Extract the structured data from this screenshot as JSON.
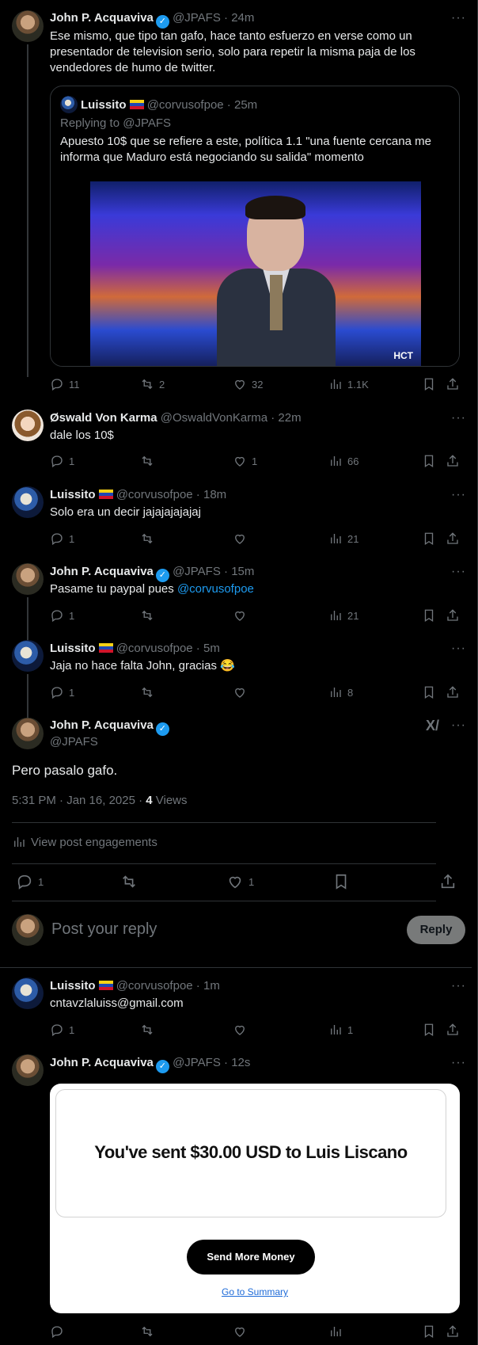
{
  "tweets": [
    {
      "name": "John P. Acquaviva",
      "handle": "@JPAFS",
      "time": "24m",
      "text": "Ese mismo, que tipo tan gafo, hace tanto esfuerzo en verse como un presentador de television serio, solo para repetir la misma paja de los vendedores de humo de twitter.",
      "replies": "11",
      "reposts": "2",
      "likes": "32",
      "views": "1.1K"
    },
    {
      "name": "Øswald Von Karma",
      "handle": "@OswaldVonKarma",
      "time": "22m",
      "text": "dale los 10$",
      "replies": "1",
      "reposts": "",
      "likes": "1",
      "views": "66"
    },
    {
      "name": "Luissito",
      "handle": "@corvusofpoe",
      "time": "18m",
      "text": "Solo era un decir jajajajajajaj",
      "replies": "1",
      "reposts": "",
      "likes": "",
      "views": "21"
    },
    {
      "name": "John P. Acquaviva",
      "handle": "@JPAFS",
      "time": "15m",
      "text": "Pasame tu paypal pues ",
      "mention": "@corvusofpoe",
      "replies": "1",
      "reposts": "",
      "likes": "",
      "views": "21"
    },
    {
      "name": "Luissito",
      "handle": "@corvusofpoe",
      "time": "5m",
      "text": "Jaja no hace falta John, gracias 😂",
      "replies": "1",
      "reposts": "",
      "likes": "",
      "views": "8"
    },
    {
      "name": "Luissito",
      "handle": "@corvusofpoe",
      "time": "1m",
      "text": "cntavzlaluiss@gmail.com",
      "replies": "1",
      "reposts": "",
      "likes": "",
      "views": "1"
    },
    {
      "name": "John P. Acquaviva",
      "handle": "@JPAFS",
      "time": "12s"
    }
  ],
  "quote": {
    "name": "Luissito",
    "handle": "@corvusofpoe",
    "time": "25m",
    "replying_to": "Replying to @JPAFS",
    "text": "Apuesto 10$ que se refiere a este, política 1.1 \"una fuente cercana me informa que Maduro está negociando su salida\" momento",
    "image_logo": "HCT"
  },
  "focus": {
    "name": "John P. Acquaviva",
    "handle": "@JPAFS",
    "text": "Pero pasalo gafo.",
    "timestamp": "5:31 PM · Jan 16, 2025 · ",
    "views_count": "4",
    "views_label": " Views",
    "engagements": "View post engagements",
    "replies": "1",
    "likes": "1"
  },
  "reply_box": {
    "placeholder": "Post your reply",
    "button": "Reply"
  },
  "card": {
    "title": "You've sent $30.00 USD to Luis Liscano",
    "button": "Send More Money",
    "link": "Go to Summary"
  },
  "icons": {
    "verified": "verified-badge-icon",
    "more": "more-dots-icon",
    "grok": "grok-icon"
  }
}
